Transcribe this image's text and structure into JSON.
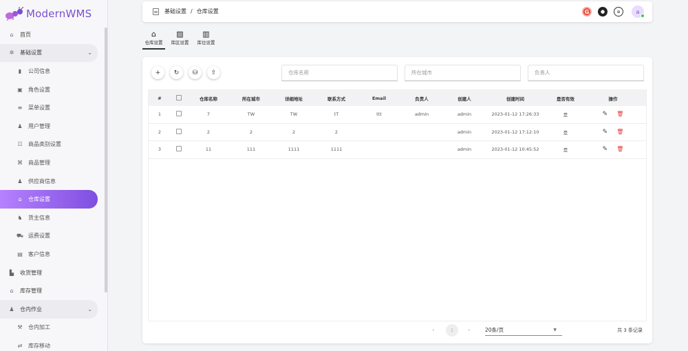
{
  "app": {
    "name": "ModernWMS"
  },
  "sidebar": {
    "items": [
      {
        "label": "首页",
        "icon": "home-icon",
        "glyph": "⌂",
        "level": 1
      },
      {
        "label": "基础设置",
        "icon": "gear-icon",
        "glyph": "✲",
        "level": 1,
        "group": true
      },
      {
        "label": "公司信息",
        "icon": "building-icon",
        "glyph": "▮",
        "level": 2
      },
      {
        "label": "角色设置",
        "icon": "badge-icon",
        "glyph": "▣",
        "level": 2
      },
      {
        "label": "菜单设置",
        "icon": "menu-icon",
        "glyph": "≡",
        "level": 2
      },
      {
        "label": "用户管理",
        "icon": "user-icon",
        "glyph": "♟",
        "level": 2
      },
      {
        "label": "商品类别设置",
        "icon": "list-icon",
        "glyph": "☷",
        "level": 2
      },
      {
        "label": "商品管理",
        "icon": "tag-icon",
        "glyph": "⌘",
        "level": 2
      },
      {
        "label": "供应商信息",
        "icon": "supplier-icon",
        "glyph": "♟",
        "level": 2
      },
      {
        "label": "仓库设置",
        "icon": "warehouse-icon",
        "glyph": "⌂",
        "level": 2,
        "active": true
      },
      {
        "label": "货主信息",
        "icon": "owner-icon",
        "glyph": "♞",
        "level": 2
      },
      {
        "label": "运费设置",
        "icon": "freight-icon",
        "glyph": "⛟",
        "level": 2
      },
      {
        "label": "客户信息",
        "icon": "customer-icon",
        "glyph": "▤",
        "level": 2
      },
      {
        "label": "收货管理",
        "icon": "receiving-icon",
        "glyph": "▙",
        "level": 1
      },
      {
        "label": "库存管理",
        "icon": "inventory-icon",
        "glyph": "⌂",
        "level": 1
      },
      {
        "label": "仓内作业",
        "icon": "operation-icon",
        "glyph": "♟",
        "level": 1,
        "group": true
      },
      {
        "label": "仓内加工",
        "icon": "process-icon",
        "glyph": "⚒",
        "level": 2
      },
      {
        "label": "库存移动",
        "icon": "move-icon",
        "glyph": "⇄",
        "level": 2
      }
    ]
  },
  "header": {
    "breadcrumb": [
      "基础设置",
      "仓库设置"
    ],
    "breadcrumb_sep": "/",
    "avatar_letter": "a"
  },
  "tabs": [
    {
      "label": "仓库设置",
      "glyph": "⌂",
      "icon": "warehouse-icon",
      "active": true
    },
    {
      "label": "库区设置",
      "glyph": "▨",
      "icon": "zone-icon"
    },
    {
      "label": "库位设置",
      "glyph": "▥",
      "icon": "location-icon"
    }
  ],
  "toolbar": {
    "add": "+",
    "refresh": "↻",
    "export": "⛁",
    "share": "⇧"
  },
  "filters": {
    "warehouse_name_placeholder": "仓库名称",
    "city_placeholder": "所在城市",
    "contact_placeholder": "负责人"
  },
  "table": {
    "columns": [
      "#",
      "",
      "仓库名称",
      "所在城市",
      "详细地址",
      "联系方式",
      "Email",
      "负责人",
      "创建人",
      "创建时间",
      "是否有效",
      "操作"
    ],
    "rows": [
      [
        "1",
        "",
        "7",
        "TW",
        "TW",
        "tT",
        "ttt",
        "admin",
        "admin",
        "2023-01-12 17:26:33",
        "是"
      ],
      [
        "2",
        "",
        "2",
        "2",
        "2",
        "2",
        "",
        "",
        "admin",
        "2023-01-12 17:12:10",
        "是"
      ],
      [
        "3",
        "",
        "11",
        "111",
        "1111",
        "1111",
        "",
        "",
        "admin",
        "2023-01-12 10:45:52",
        "是"
      ]
    ]
  },
  "pagination": {
    "current": "1",
    "page_size": "20条/页",
    "total": "共 3 条记录"
  },
  "colors": {
    "accent": "#7f4fe0",
    "accent_light": "#b681ff",
    "danger": "#e53935"
  }
}
